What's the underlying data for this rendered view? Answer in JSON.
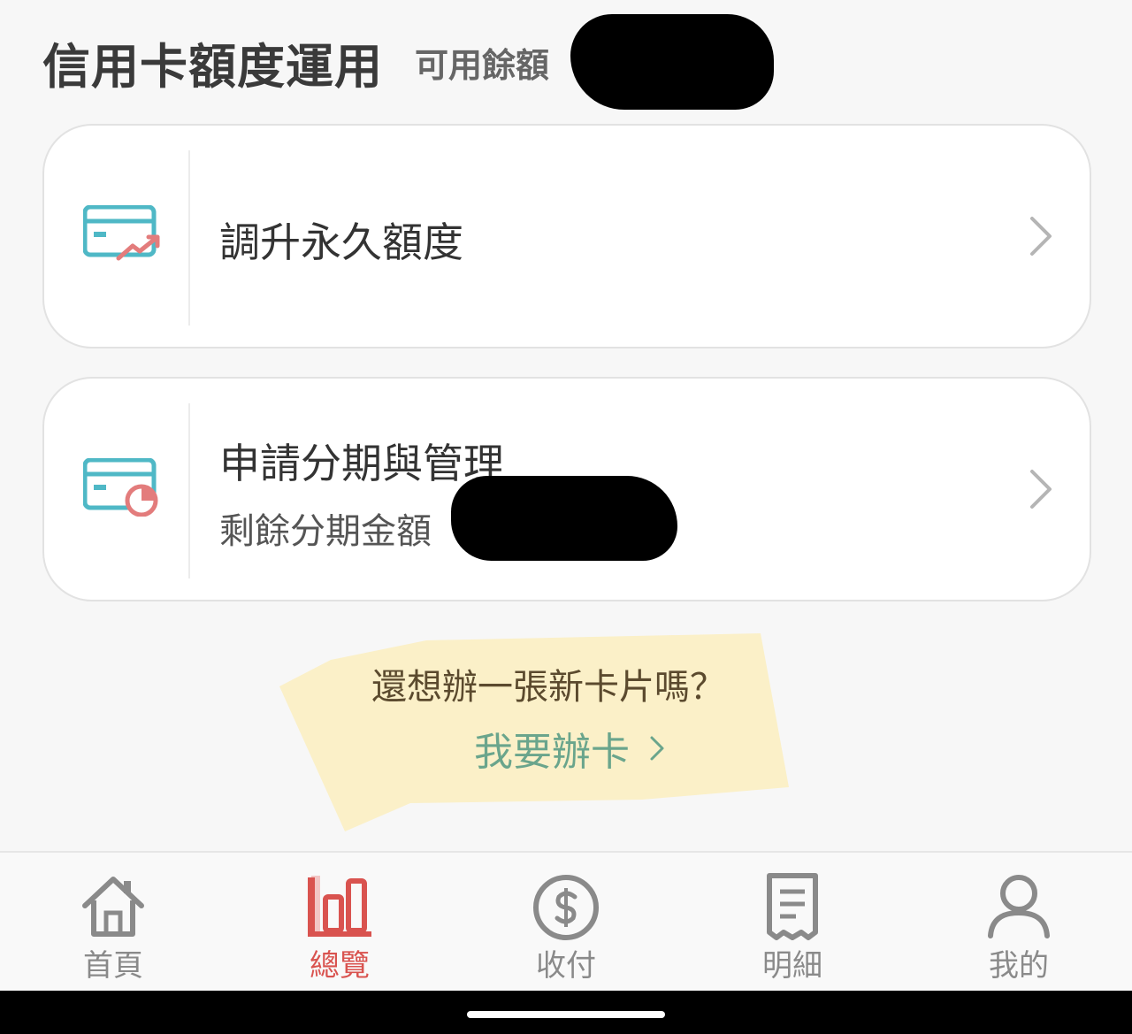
{
  "header": {
    "title": "信用卡額度運用",
    "available_label": "可用餘額"
  },
  "cards": [
    {
      "title": "調升永久額度",
      "icon": "card-trend-up-icon"
    },
    {
      "title": "申請分期與管理",
      "subtitle": "剩餘分期金額",
      "icon": "card-pie-chart-icon"
    }
  ],
  "promo": {
    "question": "還想辦一張新卡片嗎？",
    "link": "我要辦卡"
  },
  "bottom_nav": [
    {
      "label": "首頁",
      "icon": "home-icon",
      "active": false
    },
    {
      "label": "總覽",
      "icon": "bar-chart-icon",
      "active": true
    },
    {
      "label": "收付",
      "icon": "dollar-coin-icon",
      "active": false
    },
    {
      "label": "明細",
      "icon": "receipt-icon",
      "active": false
    },
    {
      "label": "我的",
      "icon": "user-icon",
      "active": false
    }
  ],
  "colors": {
    "accent_red": "#d9534f",
    "accent_teal": "#4fb8c6",
    "link_green": "#6aa58c",
    "promo_yellow": "#fbf0c8"
  }
}
